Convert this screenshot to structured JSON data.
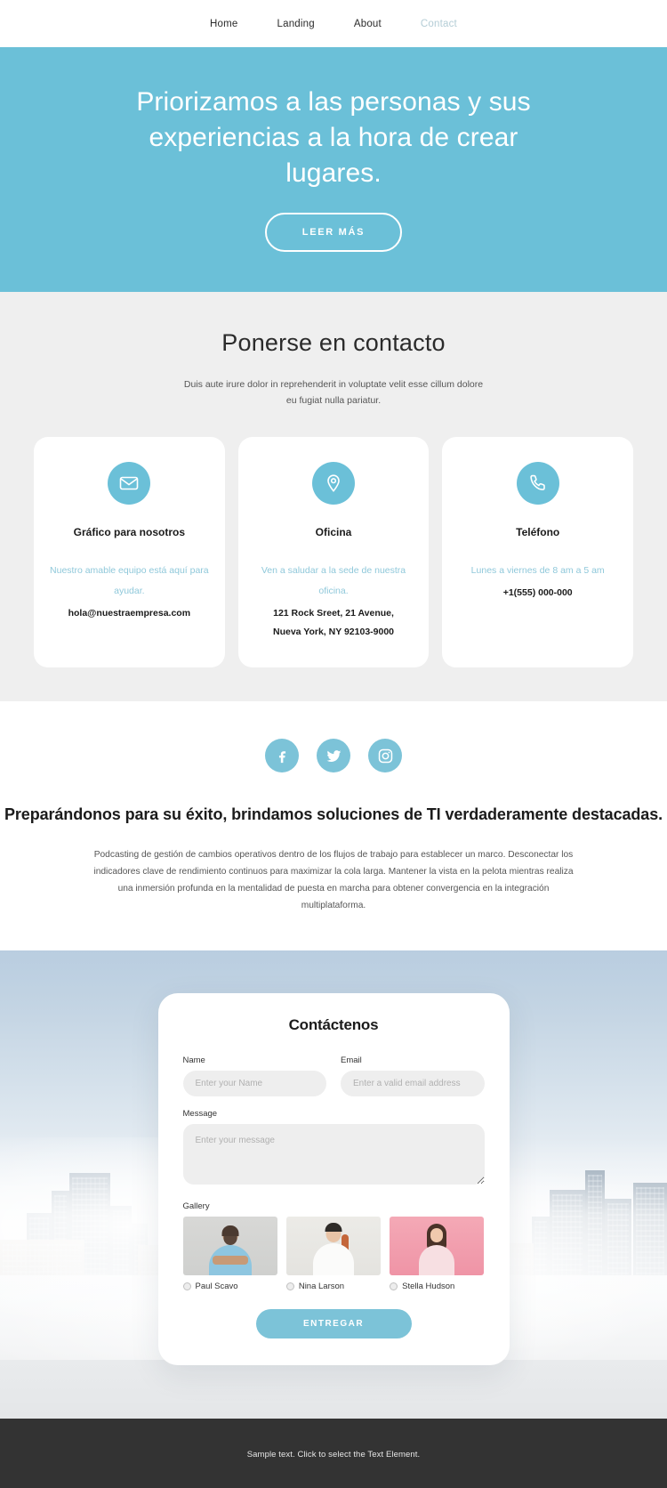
{
  "nav": {
    "items": [
      {
        "label": "Home",
        "active": false
      },
      {
        "label": "Landing",
        "active": false
      },
      {
        "label": "About",
        "active": false
      },
      {
        "label": "Contact",
        "active": true
      }
    ]
  },
  "hero": {
    "title": "Priorizamos a las personas y sus experiencias a la hora de crear lugares.",
    "button_label": "LEER MÁS",
    "bg_color": "#6bc0d8"
  },
  "contact": {
    "title": "Ponerse en contacto",
    "subtitle": "Duis aute irure dolor in reprehenderit in voluptate velit esse cillum dolore eu fugiat nulla pariatur.",
    "cards": [
      {
        "icon": "envelope-icon",
        "title": "Gráfico para nosotros",
        "description": "Nuestro amable equipo está aquí para ayudar.",
        "value": "hola@nuestraempresa.com"
      },
      {
        "icon": "map-pin-icon",
        "title": "Oficina",
        "description": "Ven a saludar a la sede de nuestra oficina.",
        "value": "121 Rock Sreet, 21 Avenue,",
        "value2": "Nueva York, NY 92103-9000"
      },
      {
        "icon": "phone-icon",
        "title": "Teléfono",
        "description": "Lunes a viernes de 8 am a 5 am",
        "value": "+1(555) 000-000"
      }
    ]
  },
  "about": {
    "socials": [
      {
        "name": "facebook-icon",
        "label": "Facebook"
      },
      {
        "name": "twitter-icon",
        "label": "Twitter"
      },
      {
        "name": "instagram-icon",
        "label": "Instagram"
      }
    ],
    "title": "Preparándonos para su éxito, brindamos soluciones de TI verdaderamente destacadas.",
    "text": "Podcasting de gestión de cambios operativos dentro de los flujos de trabajo para establecer un marco. Desconectar los indicadores clave de rendimiento continuos para maximizar la cola larga. Mantener la vista en la pelota mientras realiza una inmersión profunda en la mentalidad de puesta en marcha para obtener convergencia en la integración multiplataforma."
  },
  "form": {
    "title": "Contáctenos",
    "name_label": "Name",
    "name_placeholder": "Enter your Name",
    "name_value": "",
    "email_label": "Email",
    "email_placeholder": "Enter a valid email address",
    "email_value": "",
    "message_label": "Message",
    "message_placeholder": "Enter your message",
    "message_value": "",
    "gallery_label": "Gallery",
    "gallery": [
      {
        "name": "Paul Scavo",
        "selected": false
      },
      {
        "name": "Nina Larson",
        "selected": false
      },
      {
        "name": "Stella Hudson",
        "selected": false
      }
    ],
    "submit_label": "ENTREGAR"
  },
  "footer": {
    "text": "Sample text. Click to select the Text Element."
  }
}
